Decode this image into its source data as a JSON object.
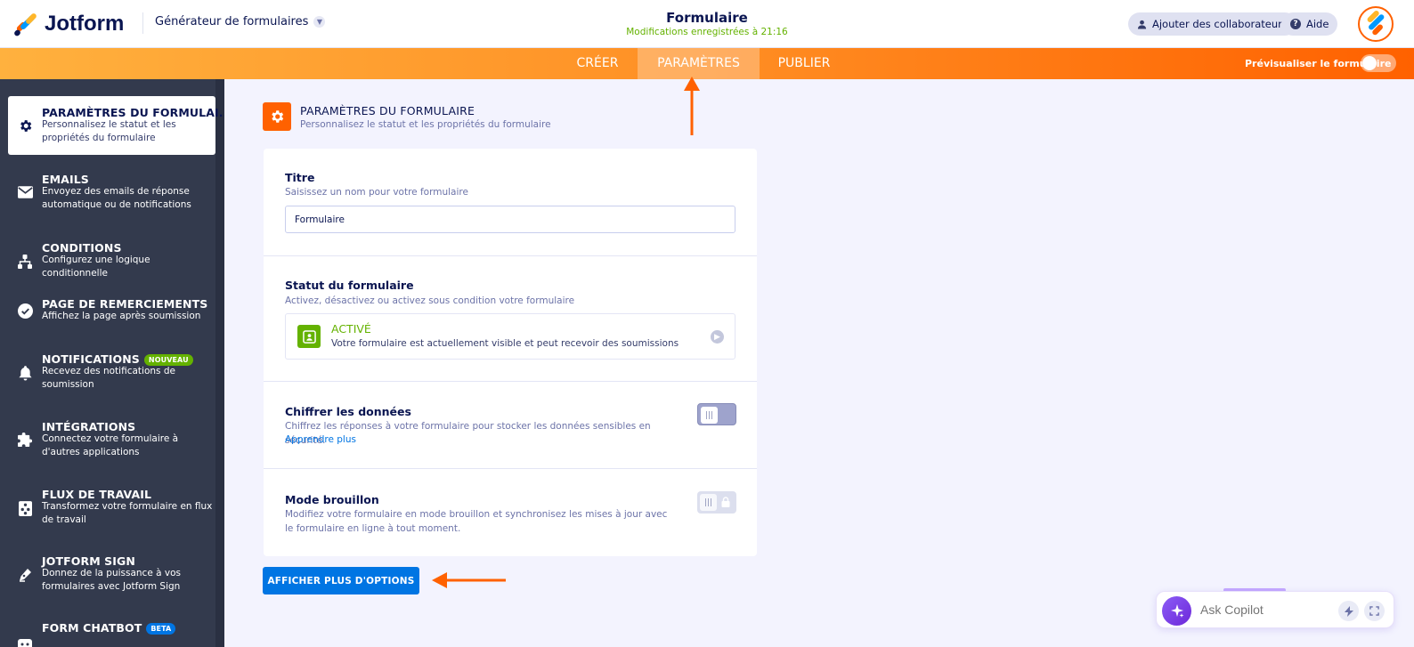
{
  "header": {
    "logo_text": "Jotform",
    "builder_menu": "Générateur de formulaires",
    "form_title": "Formulaire",
    "saved_status": "Modifications enregistrées à 21:16",
    "add_collaborators": "Ajouter des collaborateurs",
    "help": "Aide"
  },
  "nav": {
    "tabs": [
      "CRÉER",
      "PARAMÈTRES",
      "PUBLIER"
    ],
    "active_tab": "PARAMÈTRES",
    "preview_label": "Prévisualiser le formulaire",
    "preview_on": false
  },
  "sidebar": {
    "items": [
      {
        "title": "PARAMÈTRES DU FORMULAI...",
        "desc": "Personnalisez le statut et les propriétés du formulaire",
        "icon": "gear-icon",
        "active": true
      },
      {
        "title": "EMAILS",
        "desc": "Envoyez des emails de réponse automatique ou de notifications",
        "icon": "envelope-icon"
      },
      {
        "title": "CONDITIONS",
        "desc": "Configurez une logique conditionnelle",
        "icon": "sitemap-icon"
      },
      {
        "title": "PAGE DE REMERCIEMENTS",
        "desc": "Affichez la page après soumission",
        "icon": "check-circle-icon"
      },
      {
        "title": "NOTIFICATIONS",
        "badge": "NOUVEAU",
        "desc": "Recevez des notifications de soumission",
        "icon": "bell-icon"
      },
      {
        "title": "INTÉGRATIONS",
        "desc": "Connectez votre formulaire à d'autres applications",
        "icon": "puzzle-icon"
      },
      {
        "title": "FLUX DE TRAVAIL",
        "desc": "Transformez votre formulaire en flux de travail",
        "icon": "workflow-icon"
      },
      {
        "title": "JOTFORM SIGN",
        "desc": "Donnez de la puissance à vos formulaires avec Jotform Sign",
        "icon": "pen-icon"
      },
      {
        "title": "FORM CHATBOT",
        "badge": "BETA",
        "desc": "",
        "icon": "chatbot-icon"
      }
    ]
  },
  "section": {
    "title": "PARAMÈTRES DU FORMULAIRE",
    "subtitle": "Personnalisez le statut et les propriétés du formulaire"
  },
  "form_settings": {
    "title_label": "Titre",
    "title_hint": "Saisissez un nom pour votre formulaire",
    "title_value": "Formulaire",
    "status_label": "Statut du formulaire",
    "status_hint": "Activez, désactivez ou activez sous condition votre formulaire",
    "status_name": "ACTIVÉ",
    "status_desc": "Votre formulaire est actuellement visible et peut recevoir des soumissions",
    "encrypt_label": "Chiffrer les données",
    "encrypt_hint": "Chiffrez les réponses à votre formulaire pour stocker les données sensibles en sécurité.",
    "encrypt_link": "Apprendre plus",
    "encrypt_on": false,
    "draft_label": "Mode brouillon",
    "draft_hint": "Modifiez votre formulaire en mode brouillon et synchronisez les mises à jour avec le formulaire en ligne à tout moment.",
    "draft_on": false,
    "draft_locked": true,
    "more_options": "AFFICHER PLUS D'OPTIONS"
  },
  "copilot": {
    "placeholder": "Ask Copilot"
  },
  "colors": {
    "brand_orange": "#ff6100",
    "active_green": "#64b200",
    "primary_blue": "#0075e3",
    "sidebar_bg": "#333a4d",
    "annotation_arrow": "#ff6100"
  }
}
